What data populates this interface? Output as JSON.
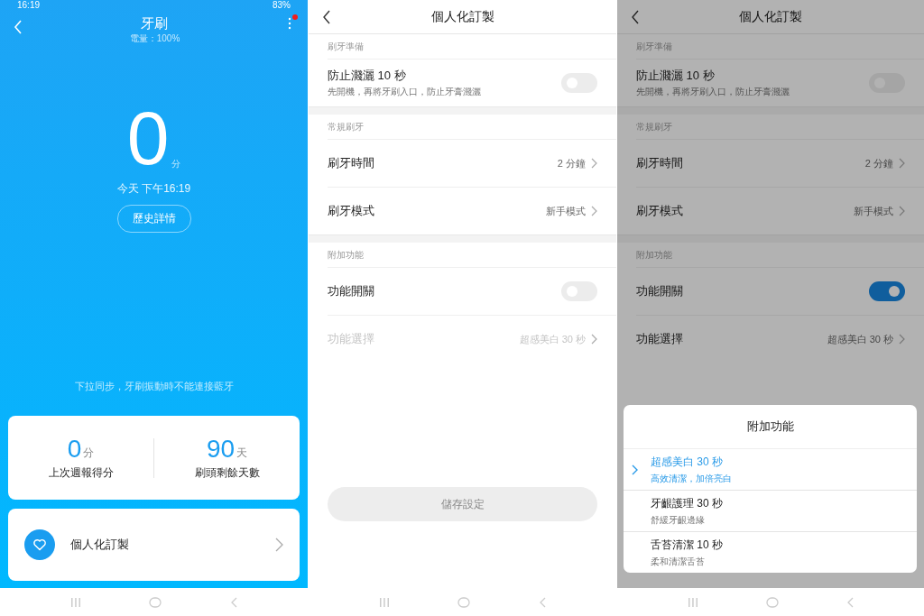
{
  "screens": [
    {
      "kind": "device",
      "status_bar": {
        "time": "16:19",
        "battery": "83%"
      },
      "title": "牙刷",
      "subtitle": "電量：100%",
      "score": {
        "value": "0",
        "unit": "分"
      },
      "time": "今天 下午16:19",
      "history_button": "歷史詳情",
      "hint": "下拉同步，牙刷振動時不能連接藍牙",
      "stats": [
        {
          "value": "0",
          "unit": "分",
          "label": "上次週報得分"
        },
        {
          "value": "90",
          "unit": "天",
          "label": "刷頭剩餘天數"
        }
      ],
      "menu_item": "個人化訂製"
    },
    {
      "kind": "settings",
      "title": "個人化訂製",
      "dimmed": false,
      "sections": [
        {
          "header": "刷牙準備",
          "items": [
            {
              "kind": "toggle",
              "label": "防止濺灑 10 秒",
              "description": "先開機，再將牙刷入口，防止牙膏濺灑",
              "on": false
            }
          ]
        },
        {
          "header": "常規刷牙",
          "items": [
            {
              "kind": "link",
              "label": "刷牙時間",
              "value": "2 分鐘",
              "disabled": false
            },
            {
              "kind": "link",
              "label": "刷牙模式",
              "value": "新手模式",
              "disabled": false
            }
          ]
        },
        {
          "header": "附加功能",
          "items": [
            {
              "kind": "toggle",
              "label": "功能開關",
              "on": false
            },
            {
              "kind": "link",
              "label": "功能選擇",
              "value": "超感美白 30 秒",
              "disabled": true
            }
          ]
        }
      ],
      "save_button": "儲存設定"
    },
    {
      "kind": "settings",
      "title": "個人化訂製",
      "dimmed": true,
      "sections": [
        {
          "header": "刷牙準備",
          "items": [
            {
              "kind": "toggle",
              "label": "防止濺灑 10 秒",
              "description": "先開機，再將牙刷入口，防止牙膏濺灑",
              "on": false
            }
          ]
        },
        {
          "header": "常規刷牙",
          "items": [
            {
              "kind": "link",
              "label": "刷牙時間",
              "value": "2 分鐘",
              "disabled": false
            },
            {
              "kind": "link",
              "label": "刷牙模式",
              "value": "新手模式",
              "disabled": false
            }
          ]
        },
        {
          "header": "附加功能",
          "items": [
            {
              "kind": "toggle",
              "label": "功能開關",
              "on": true
            },
            {
              "kind": "link",
              "label": "功能選擇",
              "value": "超感美白 30 秒",
              "disabled": false
            }
          ]
        }
      ],
      "sheet": {
        "title": "附加功能",
        "options": [
          {
            "label": "超感美白 30 秒",
            "description": "高效清潔，加倍亮白",
            "selected": true
          },
          {
            "label": "牙齦護理 30 秒",
            "description": "舒緩牙齦邊緣",
            "selected": false
          },
          {
            "label": "舌苔清潔 10 秒",
            "description": "柔和清潔舌苔",
            "selected": false
          }
        ]
      }
    }
  ]
}
